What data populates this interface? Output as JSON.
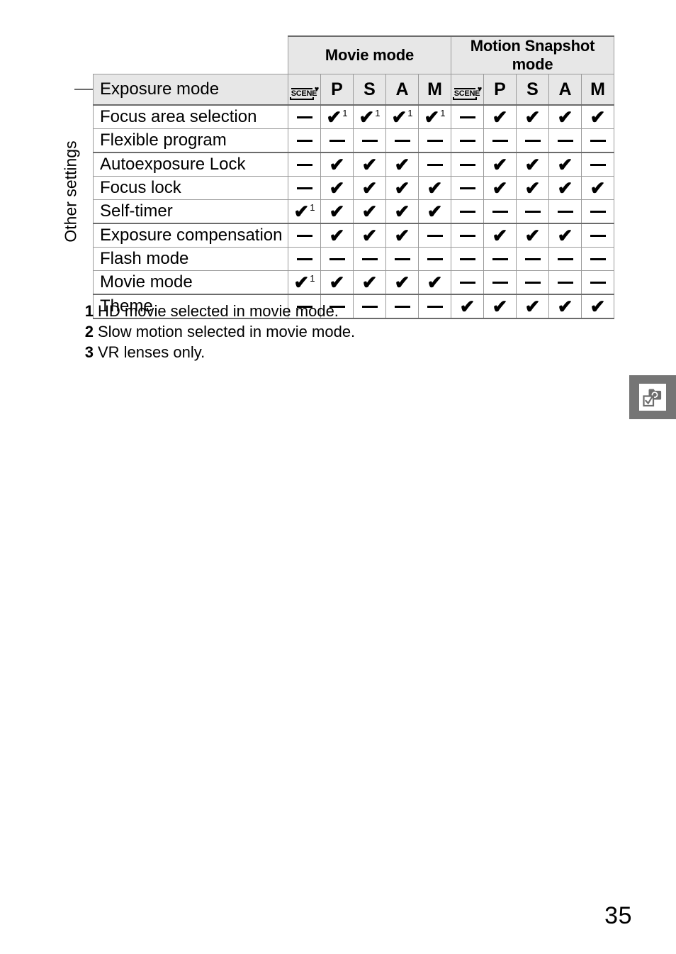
{
  "page": {
    "number": "35",
    "side_label": "Other settings",
    "side_tab_icon": "camera-checkbox-icon"
  },
  "table": {
    "corner_label": "Exposure mode",
    "groups": [
      {
        "label": "Movie mode",
        "span": 5
      },
      {
        "label": "Motion Snapshot mode",
        "span": 5
      }
    ],
    "mode_columns": [
      {
        "id": "movie-scene",
        "label": "SCENE",
        "icon": "scene-heart-icon"
      },
      {
        "id": "movie-p",
        "label": "P",
        "icon": null
      },
      {
        "id": "movie-s",
        "label": "S",
        "icon": null
      },
      {
        "id": "movie-a",
        "label": "A",
        "icon": null
      },
      {
        "id": "movie-m",
        "label": "M",
        "icon": null
      },
      {
        "id": "snap-scene",
        "label": "SCENE",
        "icon": "scene-heart-icon"
      },
      {
        "id": "snap-p",
        "label": "P",
        "icon": null
      },
      {
        "id": "snap-s",
        "label": "S",
        "icon": null
      },
      {
        "id": "snap-a",
        "label": "A",
        "icon": null
      },
      {
        "id": "snap-m",
        "label": "M",
        "icon": null
      }
    ],
    "rows": [
      {
        "label": "Focus area selection",
        "cells": [
          "-",
          "v1",
          "v1",
          "v1",
          "v1",
          "-",
          "v",
          "v",
          "v",
          "v"
        ],
        "thick_below": false
      },
      {
        "label": "Flexible program",
        "cells": [
          "-",
          "-",
          "-",
          "-",
          "-",
          "-",
          "-",
          "-",
          "-",
          "-"
        ],
        "thick_below": true
      },
      {
        "label": "Autoexposure Lock",
        "cells": [
          "-",
          "v",
          "v",
          "v",
          "-",
          "-",
          "v",
          "v",
          "v",
          "-"
        ],
        "thick_below": false
      },
      {
        "label": "Focus lock",
        "cells": [
          "-",
          "v",
          "v",
          "v",
          "v",
          "-",
          "v",
          "v",
          "v",
          "v"
        ],
        "thick_below": false
      },
      {
        "label": "Self-timer",
        "cells": [
          "v1",
          "v",
          "v",
          "v",
          "v",
          "-",
          "-",
          "-",
          "-",
          "-"
        ],
        "thick_below": true
      },
      {
        "label": "Exposure compensation",
        "cells": [
          "-",
          "v",
          "v",
          "v",
          "-",
          "-",
          "v",
          "v",
          "v",
          "-"
        ],
        "thick_below": false
      },
      {
        "label": "Flash mode",
        "cells": [
          "-",
          "-",
          "-",
          "-",
          "-",
          "-",
          "-",
          "-",
          "-",
          "-"
        ],
        "thick_below": false
      },
      {
        "label": "Movie mode",
        "cells": [
          "v1",
          "v",
          "v",
          "v",
          "v",
          "-",
          "-",
          "-",
          "-",
          "-"
        ],
        "thick_below": true
      },
      {
        "label": "Theme",
        "cells": [
          "-",
          "-",
          "-",
          "-",
          "-",
          "v",
          "v",
          "v",
          "v",
          "v"
        ],
        "thick_below": false
      }
    ]
  },
  "footnotes": [
    {
      "num": "1",
      "text": "HD movie selected in movie mode."
    },
    {
      "num": "2",
      "text": "Slow motion selected in movie mode."
    },
    {
      "num": "3",
      "text": "VR lenses only."
    }
  ],
  "colors": {
    "header_bg": "#e7e7e7",
    "rule": "#9a9a9a",
    "thick_rule": "#6b6b6b",
    "tab_bg": "#757575",
    "text": "#000000"
  }
}
